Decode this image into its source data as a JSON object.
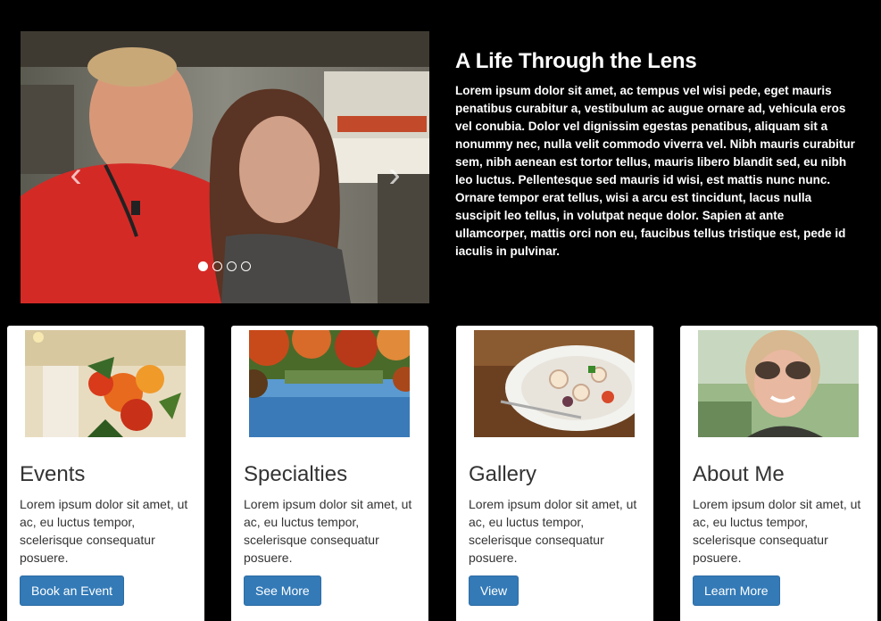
{
  "carousel": {
    "prev_glyph": "‹",
    "next_glyph": "›",
    "active_index": 0,
    "slide_count": 4
  },
  "hero": {
    "title": "A Life Through the Lens",
    "body": "Lorem ipsum dolor sit amet, ac tempus vel wisi pede, eget mauris penatibus curabitur a, vestibulum ac augue ornare ad, vehicula eros vel conubia. Dolor vel dignissim egestas penatibus, aliquam sit a nonummy nec, nulla velit commodo viverra vel. Nibh mauris curabitur sem, nibh aenean est tortor tellus, mauris libero blandit sed, eu nibh leo luctus. Pellentesque sed mauris id wisi, est mattis nunc nunc. Ornare tempor erat tellus, wisi a arcu est tincidunt, lacus nulla suscipit leo tellus, in volutpat neque dolor. Sapien at ante ullamcorper, mattis orci non eu, faucibus tellus tristique est, pede id iaculis in pulvinar."
  },
  "cards": [
    {
      "title": "Events",
      "text": "Lorem ipsum dolor sit amet, ut ac, eu luctus tempor, scelerisque consequatur posuere.",
      "button": "Book an Event"
    },
    {
      "title": "Specialties",
      "text": "Lorem ipsum dolor sit amet, ut ac, eu luctus tempor, scelerisque consequatur posuere.",
      "button": "See More"
    },
    {
      "title": "Gallery",
      "text": "Lorem ipsum dolor sit amet, ut ac, eu luctus tempor, scelerisque consequatur posuere.",
      "button": "View"
    },
    {
      "title": "About Me",
      "text": "Lorem ipsum dolor sit amet, ut ac, eu luctus tempor, scelerisque consequatur posuere.",
      "button": "Learn More"
    }
  ],
  "colors": {
    "background": "#000000",
    "button": "#337ab7",
    "card": "#ffffff"
  }
}
